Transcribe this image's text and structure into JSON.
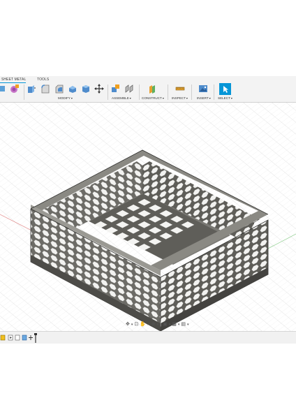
{
  "tabs": [
    {
      "label": "SHEET METAL",
      "active": false
    },
    {
      "label": "TOOLS",
      "active": true
    }
  ],
  "groups": {
    "modify": "MODIFY",
    "assemble": "ASSEMBLE",
    "construct": "CONSTRUCT",
    "inspect": "INSPECT",
    "insert": "INSERT",
    "select": "SELECT"
  },
  "icons": {
    "toolbar": [
      "sheet-metal-icon",
      "material-icon",
      "press-pull-icon",
      "fillet-icon",
      "chamfer-icon",
      "shell-icon",
      "combine-icon",
      "move-icon",
      "new-component-icon",
      "joint-icon",
      "offset-plane-icon",
      "measure-icon",
      "insert-image-icon",
      "select-icon"
    ],
    "nav": [
      "orbit-icon",
      "look-at-icon",
      "pan-icon",
      "zoom-icon",
      "fit-icon",
      "display-settings-icon",
      "grid-settings-icon",
      "viewports-icon"
    ],
    "timeline": [
      "previous-step-icon",
      "play-icon",
      "feature-icon",
      "sketch-icon",
      "extrude-icon",
      "pattern-icon",
      "marker-icon"
    ]
  },
  "colors": {
    "accent": "#0696d7",
    "model_dark": "#4a4a48",
    "model_mid": "#6f6f6a",
    "model_light": "#8c8b85",
    "grid": "#e3e3e3",
    "axis_red": "#e08080",
    "axis_green": "#88cc88"
  }
}
